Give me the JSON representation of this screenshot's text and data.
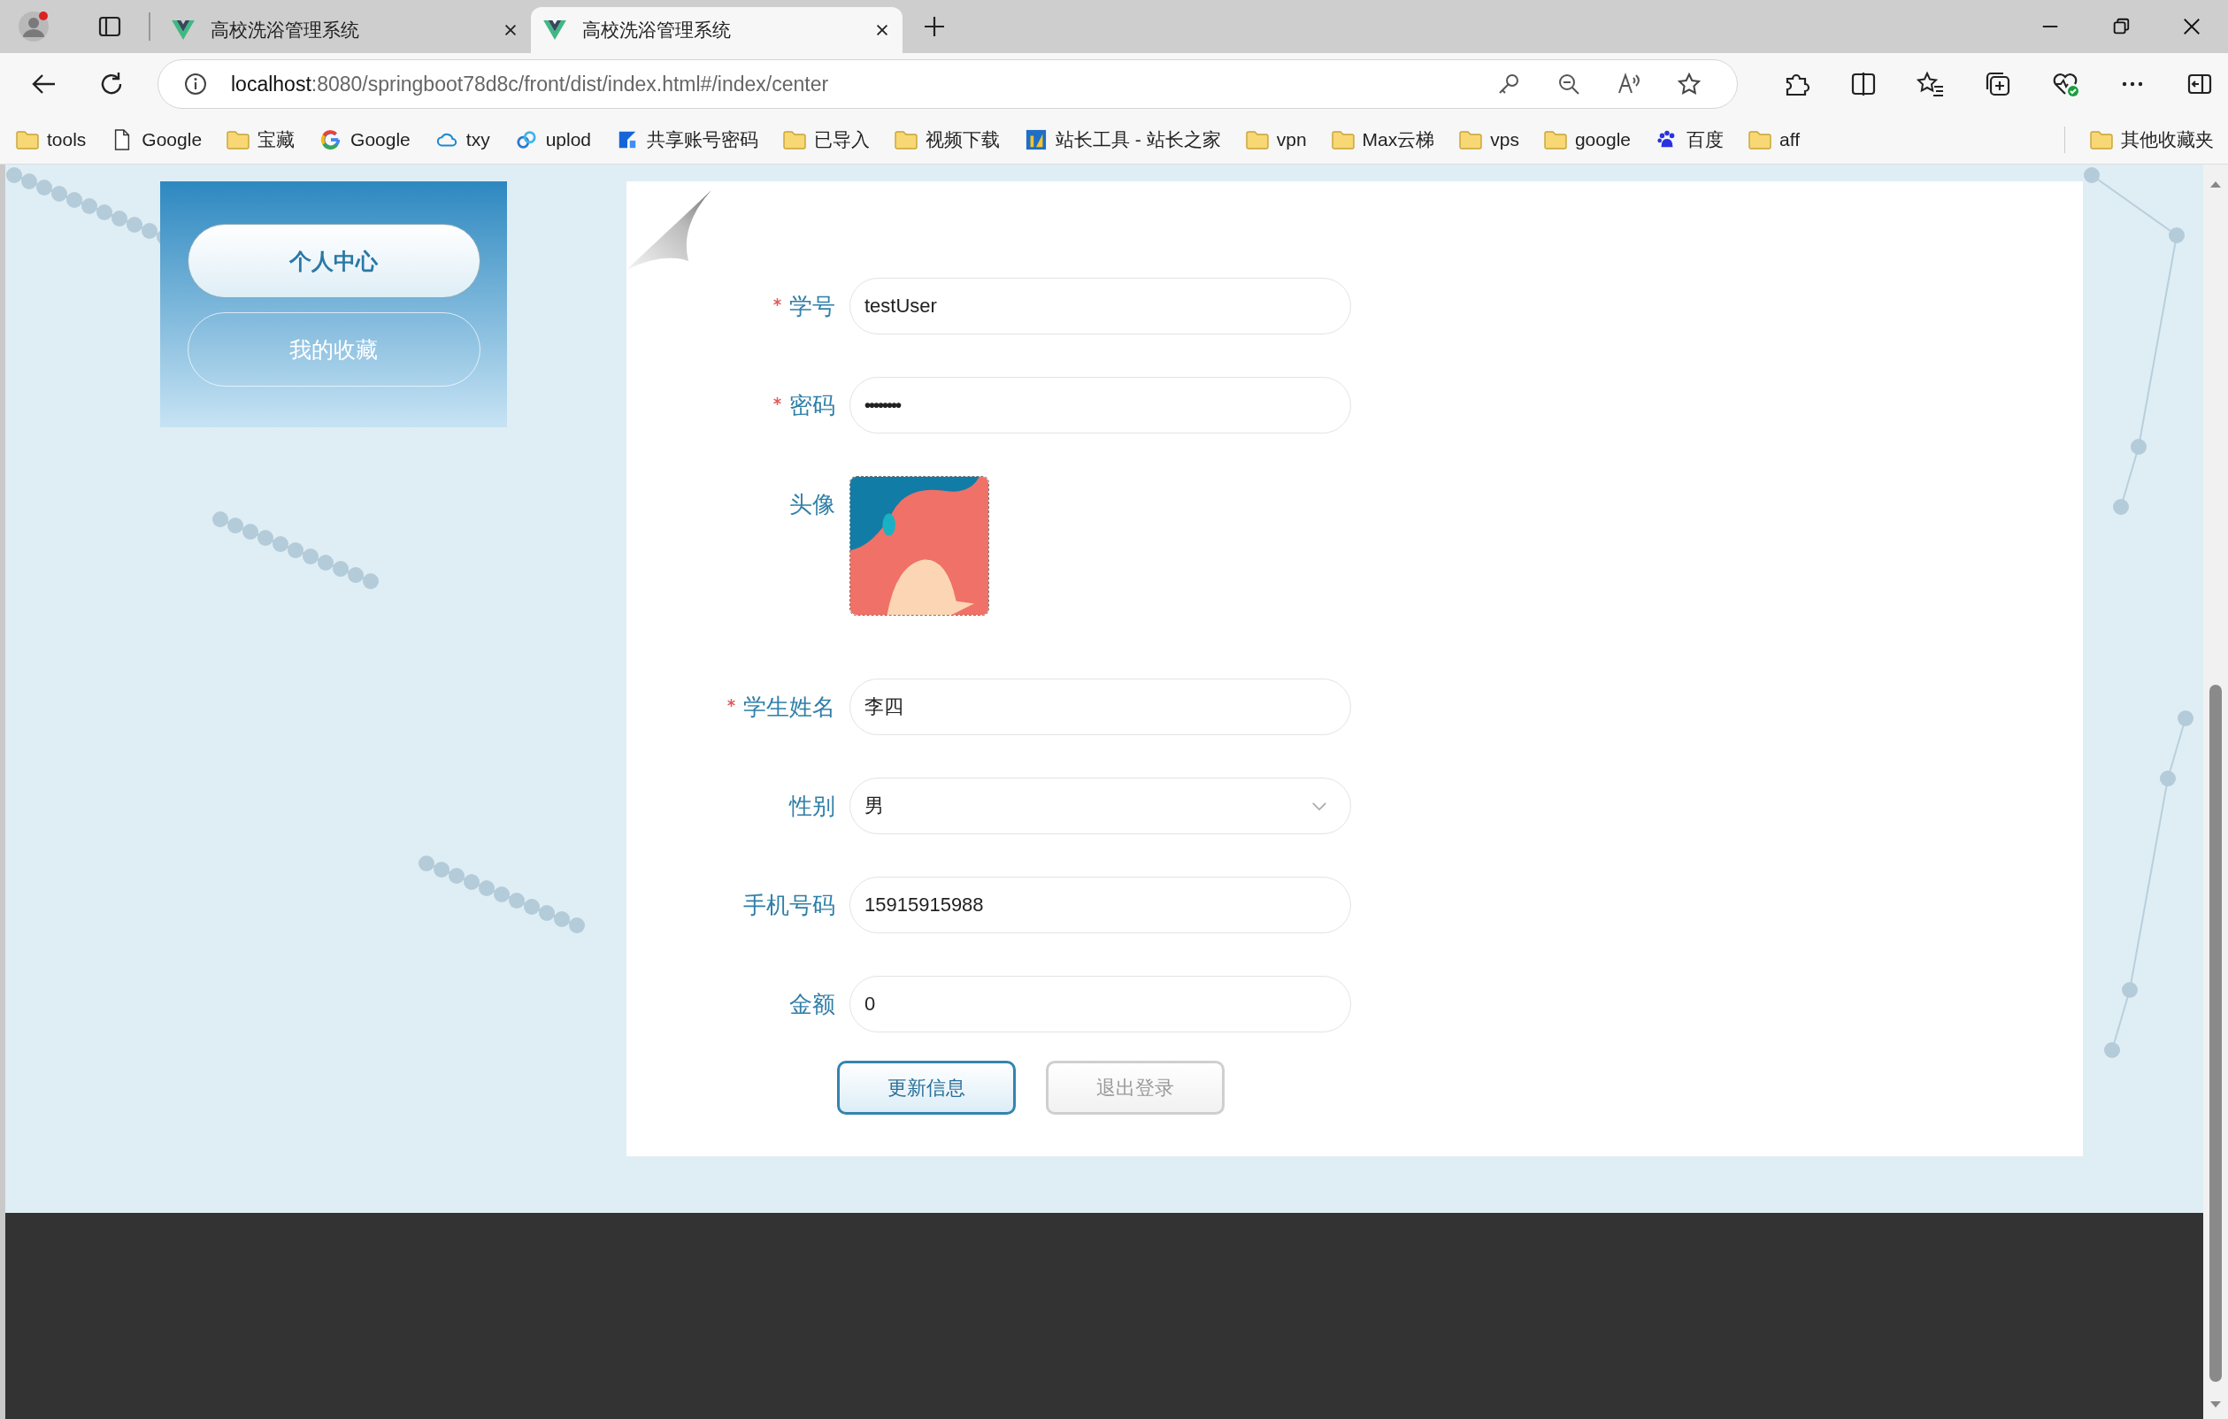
{
  "browser": {
    "tabs": [
      {
        "title": "高校洗浴管理系统",
        "selected": false
      },
      {
        "title": "高校洗浴管理系统",
        "selected": true
      }
    ],
    "address": {
      "host": "localhost",
      "path": ":8080/springboot78d8c/front/dist/index.html#/index/center"
    },
    "bookmarks": [
      {
        "label": "tools",
        "kind": "folder"
      },
      {
        "label": "Google",
        "kind": "page"
      },
      {
        "label": "宝藏",
        "kind": "folder"
      },
      {
        "label": "Google",
        "kind": "google"
      },
      {
        "label": "txy",
        "kind": "cloud"
      },
      {
        "label": "uplod",
        "kind": "swirl"
      },
      {
        "label": "共享账号密码",
        "kind": "share"
      },
      {
        "label": "已导入",
        "kind": "folder"
      },
      {
        "label": "视频下载",
        "kind": "folder"
      },
      {
        "label": "站长工具 - 站长之家",
        "kind": "tile"
      },
      {
        "label": "vpn",
        "kind": "folder"
      },
      {
        "label": "Max云梯",
        "kind": "folder"
      },
      {
        "label": "vps",
        "kind": "folder"
      },
      {
        "label": "google",
        "kind": "folder"
      },
      {
        "label": "百度",
        "kind": "paw"
      },
      {
        "label": "aff",
        "kind": "folder"
      }
    ],
    "other_bookmarks": "其他收藏夹"
  },
  "sidebar": {
    "items": [
      {
        "label": "个人中心",
        "selected": true
      },
      {
        "label": "我的收藏",
        "selected": false
      }
    ]
  },
  "form": {
    "fields": [
      {
        "label": "学号",
        "required": true,
        "kind": "text",
        "value": "testUser"
      },
      {
        "label": "密码",
        "required": true,
        "kind": "password",
        "value": "••••••••"
      },
      {
        "label": "头像",
        "required": false,
        "kind": "avatar"
      },
      {
        "label": "学生姓名",
        "required": true,
        "kind": "text",
        "value": "李四"
      },
      {
        "label": "性别",
        "required": false,
        "kind": "select",
        "value": "男"
      },
      {
        "label": "手机号码",
        "required": false,
        "kind": "text",
        "value": "15915915988"
      },
      {
        "label": "金额",
        "required": false,
        "kind": "text",
        "value": "0"
      }
    ],
    "buttons": [
      {
        "label": "更新信息",
        "kind": "primary"
      },
      {
        "label": "退出登录",
        "kind": "secondary"
      }
    ]
  }
}
